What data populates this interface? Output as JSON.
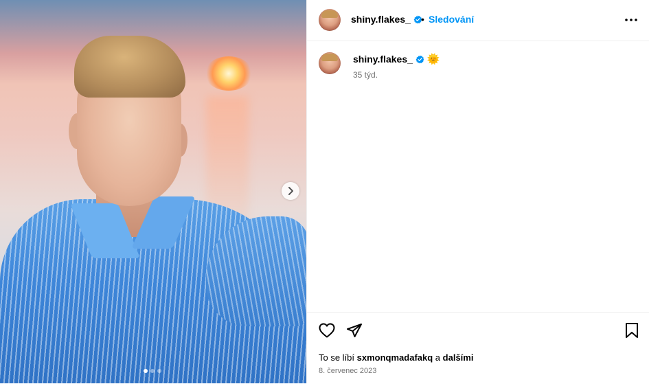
{
  "header": {
    "username": "shiny.flakes_",
    "separator": "•",
    "follow_label": "Sledování",
    "more_icon": "more-horizontal-icon"
  },
  "caption": {
    "username": "shiny.flakes_",
    "emoji": "🌞",
    "time": "35 týd."
  },
  "photo": {
    "carousel_count": 3,
    "active_index": 0
  },
  "actions": {
    "like_icon": "heart-icon",
    "share_icon": "paper-plane-icon",
    "save_icon": "bookmark-icon"
  },
  "likes": {
    "prefix": "To se líbí ",
    "user": "sxmonqmadafakq",
    "middle": " a ",
    "others": "dalšími"
  },
  "date": "8. červenec 2023",
  "colors": {
    "accent": "#0095f6",
    "verified": "#0095f6",
    "muted": "#737373"
  }
}
